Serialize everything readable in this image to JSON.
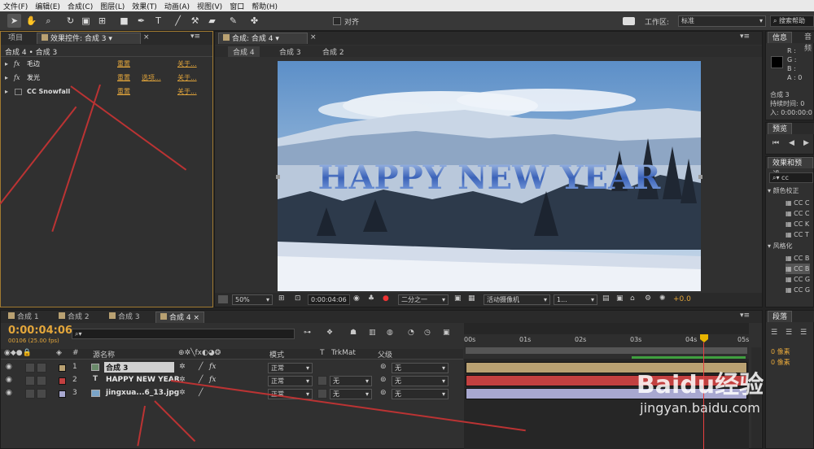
{
  "menu": [
    "文件(F)",
    "编辑(E)",
    "合成(C)",
    "图层(L)",
    "效果(T)",
    "动画(A)",
    "视图(V)",
    "窗口",
    "帮助(H)"
  ],
  "toolbar": {
    "align_label": "对齐",
    "workspace_label": "工作区:",
    "workspace_value": "标准",
    "search_help_placeholder": "搜索帮助"
  },
  "left": {
    "tab_project": "项目",
    "tab_effect_controls": "效果控件: 合成 3",
    "breadcrumb": "合成 4 • 合成 3",
    "effects": [
      {
        "name": "毛边",
        "reset": "重置",
        "options": "",
        "about": "关于..."
      },
      {
        "name": "发光",
        "reset": "重置",
        "options": "选项...",
        "about": "关于..."
      },
      {
        "name": "CC Snowfall",
        "reset": "重置",
        "options": "",
        "about": "关于..."
      }
    ]
  },
  "viewer": {
    "tab": "合成: 合成 4",
    "flow": [
      "合成 4",
      "合成 3",
      "合成 2"
    ],
    "overlay_text": "HAPPY NEW YEAR",
    "zoom": "50%",
    "timecode": "0:00:04:06",
    "resolution": "二分之一",
    "camera": "活动摄像机",
    "views": "1...",
    "exposure": "+0.0"
  },
  "right": {
    "info_tab": "信息",
    "audio_tab": "音频",
    "rgba": [
      "R :",
      "G :",
      "B :",
      "A : 0"
    ],
    "info_comp": "合成 3",
    "info_duration": "持续时间: 0",
    "info_in": "入: 0:00:00:0",
    "preview_tab": "预览",
    "effects_tab": "效果和预设",
    "search_value": "cc",
    "categories": [
      {
        "name": "颜色校正",
        "items": [
          "CC C",
          "CC C",
          "CC K",
          "CC T"
        ]
      },
      {
        "name": "风格化",
        "items": [
          "CC B",
          "CC B",
          "CC G",
          "CC G"
        ]
      }
    ],
    "paragraph_tab": "段落",
    "pixels": [
      "0 像素",
      "0 像素"
    ]
  },
  "timeline": {
    "tabs": [
      "合成 1",
      "合成 2",
      "合成 3",
      "合成 4"
    ],
    "timecode": "0:00:04:06",
    "frames": "00106 (25.00 fps)",
    "search_placeholder": "",
    "headers": {
      "num": "#",
      "name": "源名称",
      "mode": "模式",
      "t": "T",
      "trkmat": "TrkMat",
      "parent": "父级"
    },
    "ruler": [
      "00s",
      "01s",
      "02s",
      "03s",
      "04s",
      "05s"
    ],
    "layers": [
      {
        "num": "1",
        "name": "合成 3",
        "mode": "正常",
        "trkmat": "",
        "parent": "无",
        "color": "#b9a172"
      },
      {
        "num": "2",
        "name": "HAPPY NEW YEAR",
        "mode": "正常",
        "trkmat": "无",
        "parent": "无",
        "color": "#c24040"
      },
      {
        "num": "3",
        "name": "jingxua...6_13.jpg",
        "mode": "正常",
        "trkmat": "无",
        "parent": "无",
        "color": "#a8a8d0"
      }
    ]
  },
  "watermark": {
    "brand": "Baidu经验",
    "url": "jingyan.baidu.com"
  },
  "colors": {
    "accent": "#e3a63b",
    "layer1": "#b9a172",
    "layer2": "#c24040",
    "layer3": "#a8a8d0",
    "cti": "#e8b400"
  }
}
